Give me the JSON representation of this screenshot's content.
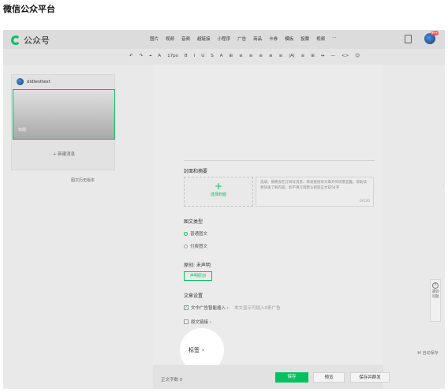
{
  "page_title": "微信公众平台",
  "top": {
    "app_name": "公众号",
    "menu": [
      "图片",
      "视频",
      "音频",
      "超链接",
      "小程序",
      "广告",
      "商品",
      "卡券",
      "模板",
      "投票",
      "视频",
      "···"
    ],
    "badge": "99+"
  },
  "fmt_items": [
    "↶",
    "↷",
    "⌖",
    "A",
    "17px",
    "B",
    "I",
    "U",
    "S",
    "A",
    "⊞",
    "≡",
    "≡",
    "≡",
    "≡",
    "≡",
    "|A|",
    "≡",
    "⊞",
    "↔",
    "—",
    "<>",
    "☺"
  ],
  "left": {
    "account": "didtesttest",
    "cover_caption": "标题",
    "new_msg": "+ 新建消息",
    "history": "图文历史版本"
  },
  "form": {
    "cover_section": "封面和摘要",
    "cover_plus": "+",
    "cover_label": "选择封面",
    "summary_placeholder": "选填，摘要会在订阅号消息、转发链接等文章外的场景显露，帮助读者快速了解内容，如不填写则默认抓取正文前54字",
    "summary_count": "0/120",
    "type_section": "图文类型",
    "type_normal": "普通图文",
    "type_paid": "付费图文",
    "origin_label": "原创:  未声明",
    "origin_button": "声明原创",
    "settings_section": "文章设置",
    "ad_label": "文中广告智能插入 ›",
    "ad_note": "本文显示可插入0条广告",
    "source_label": "原文链接 ›",
    "tag_label": "标签",
    "tag_chevron": "›"
  },
  "bottom": {
    "word_count": "正文字数  0",
    "save": "保存",
    "preview": "预览",
    "publish": "保存并群发"
  },
  "right_tool": {
    "icon": "?",
    "text": "遇到问题"
  },
  "shortcut": "⌘ 自动保存"
}
